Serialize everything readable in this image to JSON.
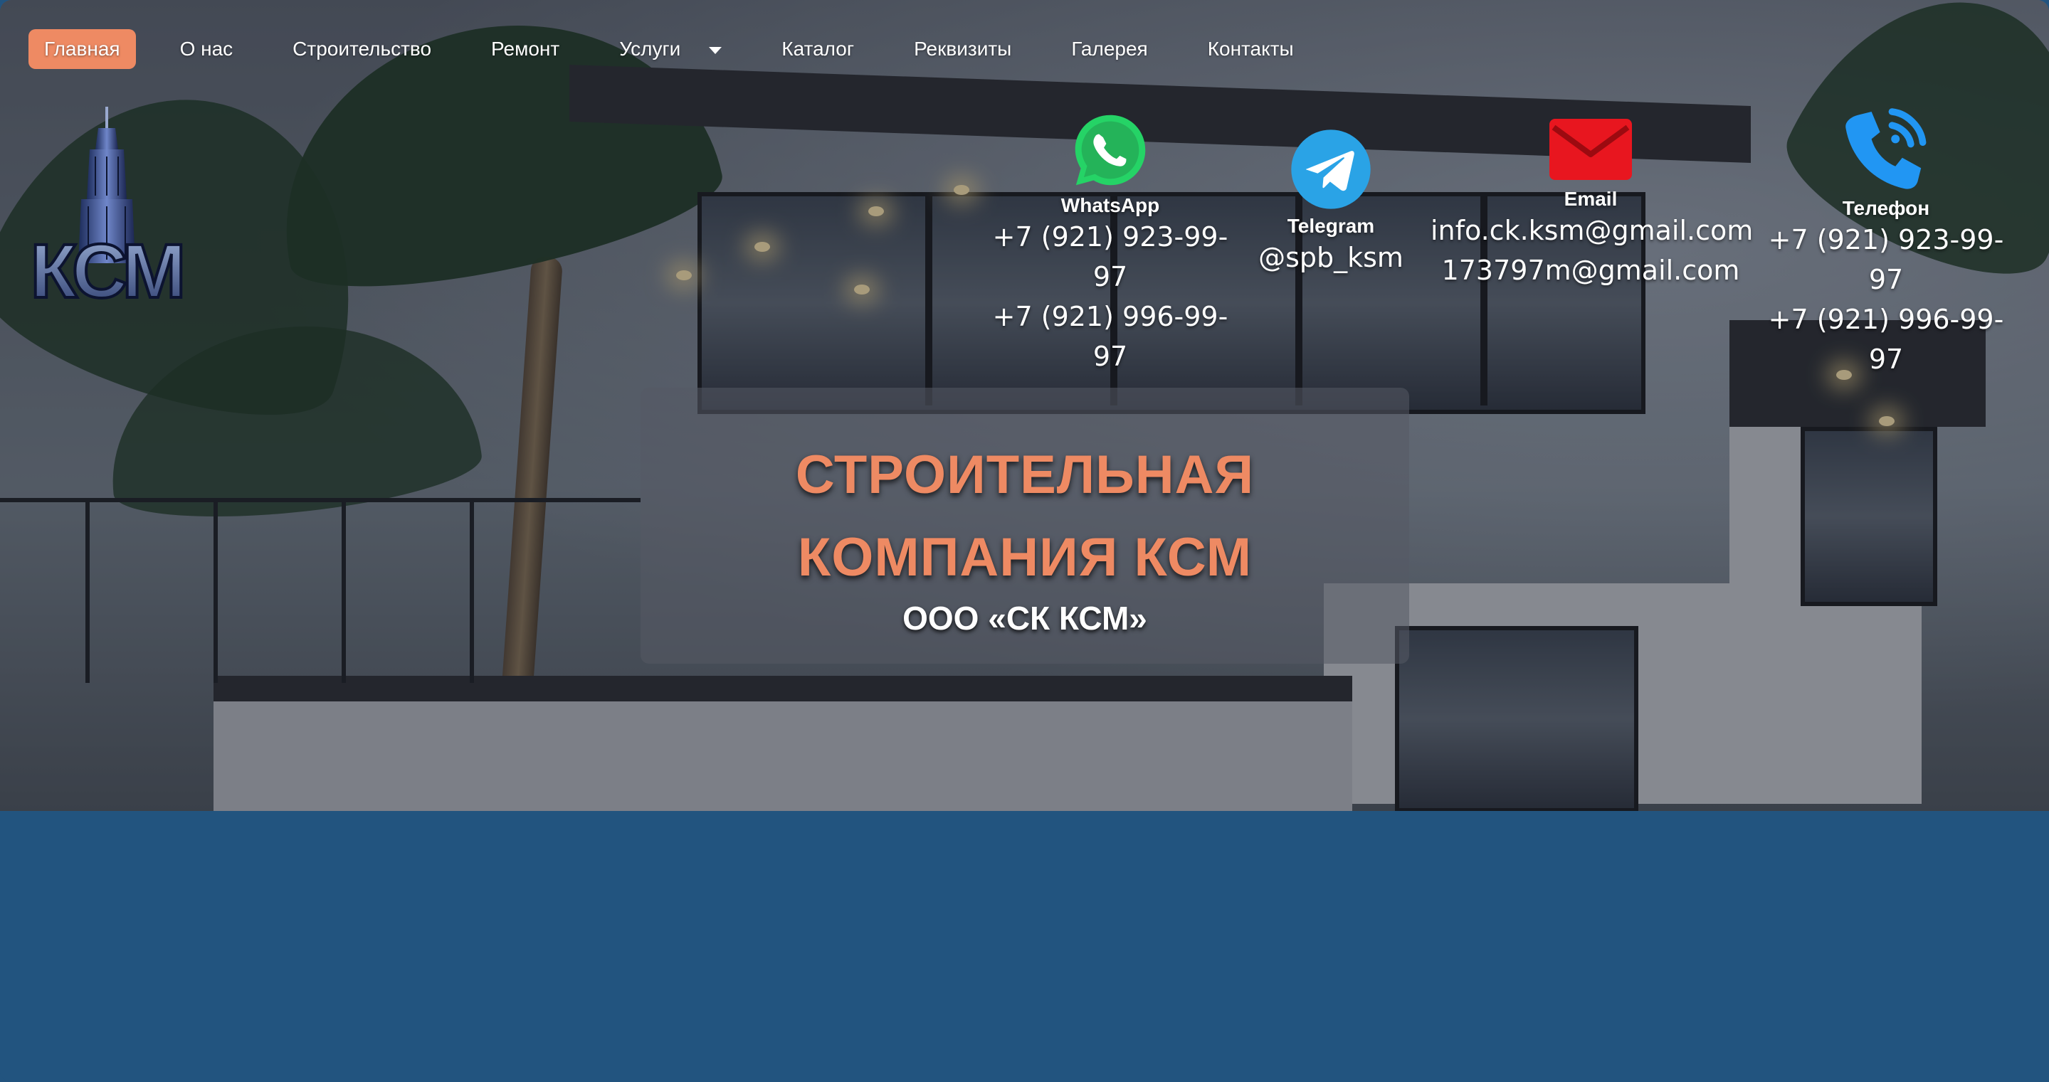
{
  "nav": {
    "items": [
      {
        "label": "Главная",
        "active": true
      },
      {
        "label": "О нас"
      },
      {
        "label": "Строительство"
      },
      {
        "label": "Ремонт"
      },
      {
        "label": "Услуги",
        "dropdown": true
      },
      {
        "label": "Каталог"
      },
      {
        "label": "Реквизиты"
      },
      {
        "label": "Галерея"
      },
      {
        "label": "Контакты"
      }
    ]
  },
  "logo": {
    "text": "КСМ"
  },
  "contacts": {
    "whatsapp": {
      "label": "WhatsApp",
      "lines": [
        "+7 (921) 923-99-97",
        "+7 (921) 996-99-97"
      ],
      "icon": "whatsapp-icon"
    },
    "telegram": {
      "label": "Telegram",
      "lines": [
        "@spb_ksm"
      ],
      "icon": "telegram-icon"
    },
    "email": {
      "label": "Email",
      "lines": [
        "info.ck.ksm@gmail.com",
        "173797m@gmail.com"
      ],
      "icon": "envelope-icon"
    },
    "phone": {
      "label": "Телефон",
      "lines": [
        "+7 (921) 923-99-97",
        "+7 (921) 996-99-97"
      ],
      "icon": "phone-icon"
    }
  },
  "hero": {
    "title_line1": "СТРОИТЕЛЬНАЯ",
    "title_line2": "КОМПАНИЯ КСМ",
    "subtitle": "ООО «СК КСМ»"
  },
  "colors": {
    "accent": "#ee8a63",
    "footer_band": "#22547f",
    "whatsapp": "#25d366",
    "telegram": "#2aa3e6",
    "email": "#e8161f",
    "phone": "#2196f3"
  }
}
